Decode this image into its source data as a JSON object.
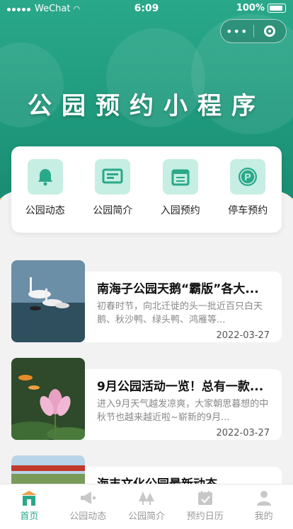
{
  "status_bar": {
    "carrier": "WeChat",
    "time": "6:09",
    "battery": "100%"
  },
  "capsule": {
    "more_label": "•••"
  },
  "hero": {
    "title": "公园预约小程序"
  },
  "menu": [
    {
      "label": "公园动态",
      "icon": "bell-icon"
    },
    {
      "label": "公园简介",
      "icon": "board-icon"
    },
    {
      "label": "入园预约",
      "icon": "calendar-icon"
    },
    {
      "label": "停车预约",
      "icon": "parking-icon"
    }
  ],
  "news": [
    {
      "title": "南海子公园天鹅“霸版”各大...",
      "desc": "初春时节，向北迁徙的头一批近百只白天鹅、秋沙鸭、绿头鸭、鸿雁等...",
      "date": "2022-03-27"
    },
    {
      "title": "9月公园活动一览！总有一款...",
      "desc": "进入9月天气越发凉爽，大家朝思暮想的中秋节也越来越近啦~崭新的9月...",
      "date": "2022-03-27"
    },
    {
      "title": "海丰文化公园最新动态",
      "desc": "",
      "date": ""
    }
  ],
  "tabs": [
    {
      "label": "首页",
      "icon": "home-icon",
      "active": true
    },
    {
      "label": "公园动态",
      "icon": "megaphone-icon",
      "active": false
    },
    {
      "label": "公园简介",
      "icon": "trees-icon",
      "active": false
    },
    {
      "label": "预约日历",
      "icon": "calendar-check-icon",
      "active": false
    },
    {
      "label": "我的",
      "icon": "user-icon",
      "active": false
    }
  ],
  "colors": {
    "primary": "#2aa88a",
    "icon_bg": "#c6eee3",
    "accent": "#f0a04a"
  }
}
